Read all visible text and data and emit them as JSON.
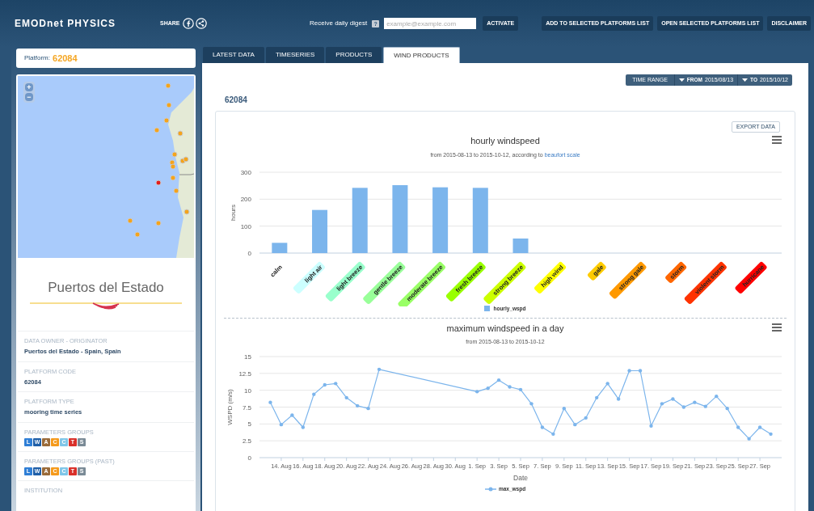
{
  "header": {
    "logo": "EMODnet PHYSICS",
    "share_label": "SHARE",
    "digest_label": "Receive daily digest",
    "help_badge": "?",
    "email_placeholder": "example@example.com",
    "buttons": [
      "ACTIVATE",
      "ADD TO SELECTED PLATFORMS LIST",
      "OPEN SELECTED PLATFORMS LIST",
      "DISCLAIMER"
    ]
  },
  "sidebar": {
    "platform_label": "Platform:",
    "platform_code": "62084",
    "map": {
      "zoom_in": "+",
      "zoom_out": "−"
    },
    "logo_text": "Puertos del Estado",
    "fields": [
      {
        "kind": "text",
        "label": "DATA OWNER - ORIGINATOR",
        "value": "Puertos del Estado - Spain, Spain"
      },
      {
        "kind": "text",
        "label": "PLATFORM CODE",
        "value": "62084"
      },
      {
        "kind": "text",
        "label": "PLATFORM TYPE",
        "value": "mooring time series"
      },
      {
        "kind": "badges",
        "label": "PARAMETERS GROUPS",
        "badges": [
          {
            "letter": "L",
            "color": "#2f7fd6"
          },
          {
            "letter": "W",
            "color": "#1f5fa8"
          },
          {
            "letter": "A",
            "color": "#9a6b3a"
          },
          {
            "letter": "C",
            "color": "#f59a1c"
          },
          {
            "letter": "C",
            "color": "#7fc6e8"
          },
          {
            "letter": "T",
            "color": "#d9302a"
          },
          {
            "letter": "S",
            "color": "#7a8a96"
          }
        ]
      },
      {
        "kind": "badges",
        "label": "PARAMETERS GROUPS (PAST)",
        "badges": [
          {
            "letter": "L",
            "color": "#2f7fd6"
          },
          {
            "letter": "W",
            "color": "#1f5fa8"
          },
          {
            "letter": "A",
            "color": "#9a6b3a"
          },
          {
            "letter": "C",
            "color": "#f59a1c"
          },
          {
            "letter": "C",
            "color": "#7fc6e8"
          },
          {
            "letter": "T",
            "color": "#d9302a"
          },
          {
            "letter": "S",
            "color": "#7a8a96"
          }
        ]
      },
      {
        "kind": "text",
        "label": "INSTITUTION"
      }
    ]
  },
  "tabs": [
    {
      "label": "LATEST DATA",
      "selected": false
    },
    {
      "label": "TIMESERIES",
      "selected": false
    },
    {
      "label": "PRODUCTS",
      "selected": false
    },
    {
      "label": "WIND PRODUCTS",
      "selected": true
    }
  ],
  "time_range": {
    "label": "TIME RANGE",
    "from_label": "FROM",
    "from": "2015/08/13",
    "to_label": "TO",
    "to": "2015/10/12"
  },
  "platform_heading": "62084",
  "export_button": "EXPORT DATA",
  "hourly_chart": {
    "title": "hourly windspeed",
    "subtitle": "from 2015-08-13 to 2015-10-12, according to",
    "subtitle_link": "beaufort scale",
    "category_tags": [
      {
        "kind": "plain"
      },
      {
        "kind": "tag",
        "color": "#ccffff"
      },
      {
        "kind": "tag",
        "color": "#99ffcc"
      },
      {
        "kind": "tag",
        "color": "#99ff99"
      },
      {
        "kind": "tag",
        "color": "#99ff66"
      },
      {
        "kind": "tag",
        "color": "#99ff00"
      },
      {
        "kind": "tag",
        "color": "#ccff00"
      },
      {
        "kind": "tag",
        "color": "#ffff00"
      },
      {
        "kind": "tag",
        "color": "#ffcc00"
      },
      {
        "kind": "tag",
        "color": "#ff9900"
      },
      {
        "kind": "tag",
        "color": "#ff6600"
      },
      {
        "kind": "tag",
        "color": "#ff3300"
      },
      {
        "kind": "tag",
        "color": "#ff0000"
      }
    ],
    "chart_data": {
      "type": "bar",
      "ylabel": "hours",
      "categories": [
        "calm",
        "light air",
        "light breeze",
        "gentle breeze",
        "moderate breeze",
        "fresh breeze",
        "strong breeze",
        "high wind",
        "gale",
        "strong gale",
        "storm",
        "violent storm",
        "hurricane"
      ],
      "series": [
        {
          "name": "hourly_wspd",
          "color": "#7cb5ec",
          "values": [
            38,
            160,
            242,
            252,
            244,
            242,
            54,
            0,
            0,
            0,
            0,
            0,
            0
          ]
        }
      ],
      "ylim": [
        0,
        300
      ],
      "yticks": [
        0,
        100,
        200,
        300
      ]
    }
  },
  "daily_chart": {
    "title": "maximum windspeed in a day",
    "subtitle": "from 2015-08-13 to 2015-10-12",
    "chart_data": {
      "type": "line",
      "xlabel": "Date",
      "ylabel": "WSPD (m/s)",
      "x": [
        "2015-08-13",
        "2015-08-14",
        "2015-08-15",
        "2015-08-16",
        "2015-08-17",
        "2015-08-18",
        "2015-08-19",
        "2015-08-20",
        "2015-08-21",
        "2015-08-22",
        "2015-08-23",
        "2015-09-01",
        "2015-09-02",
        "2015-09-03",
        "2015-09-04",
        "2015-09-05",
        "2015-09-06",
        "2015-09-07",
        "2015-09-08",
        "2015-09-09",
        "2015-09-10",
        "2015-09-11",
        "2015-09-12",
        "2015-09-13",
        "2015-09-14",
        "2015-09-15",
        "2015-09-16",
        "2015-09-17",
        "2015-09-18",
        "2015-09-19",
        "2015-09-20",
        "2015-09-21",
        "2015-09-22",
        "2015-09-23",
        "2015-09-24",
        "2015-09-25",
        "2015-09-26",
        "2015-09-27",
        "2015-09-28"
      ],
      "series": [
        {
          "name": "max_wspd",
          "color": "#7cb5ec",
          "values": [
            8.2,
            4.9,
            6.3,
            4.5,
            9.4,
            10.8,
            11.0,
            8.9,
            7.7,
            7.3,
            13.1,
            9.8,
            10.3,
            11.5,
            10.5,
            10.1,
            8.0,
            4.5,
            3.5,
            7.3,
            4.9,
            5.9,
            8.9,
            11.0,
            8.7,
            12.9,
            12.9,
            4.7,
            8.0,
            8.7,
            7.5,
            8.2,
            7.6,
            9.1,
            7.3,
            4.5,
            2.8,
            4.5,
            3.5
          ]
        }
      ],
      "ylim": [
        0,
        15
      ],
      "yticks": [
        0,
        2.5,
        5,
        7.5,
        10,
        12.5,
        15
      ],
      "grid": true,
      "xlim": [
        "2015-08-12",
        "2015-09-29"
      ],
      "xticks": [
        {
          "value": "2015-08-14",
          "label": "14. Aug"
        },
        {
          "value": "2015-08-16",
          "label": "16. Aug"
        },
        {
          "value": "2015-08-18",
          "label": "18. Aug"
        },
        {
          "value": "2015-08-20",
          "label": "20. Aug"
        },
        {
          "value": "2015-08-22",
          "label": "22. Aug"
        },
        {
          "value": "2015-08-24",
          "label": "24. Aug"
        },
        {
          "value": "2015-08-26",
          "label": "26. Aug"
        },
        {
          "value": "2015-08-28",
          "label": "28. Aug"
        },
        {
          "value": "2015-08-30",
          "label": "30. Aug"
        },
        {
          "value": "2015-09-01",
          "label": "1. Sep"
        },
        {
          "value": "2015-09-03",
          "label": "3. Sep"
        },
        {
          "value": "2015-09-05",
          "label": "5. Sep"
        },
        {
          "value": "2015-09-07",
          "label": "7. Sep"
        },
        {
          "value": "2015-09-09",
          "label": "9. Sep"
        },
        {
          "value": "2015-09-11",
          "label": "11. Sep"
        },
        {
          "value": "2015-09-13",
          "label": "13. Sep"
        },
        {
          "value": "2015-09-15",
          "label": "15. Sep"
        },
        {
          "value": "2015-09-17",
          "label": "17. Sep"
        },
        {
          "value": "2015-09-19",
          "label": "19. Sep"
        },
        {
          "value": "2015-09-21",
          "label": "21. Sep"
        },
        {
          "value": "2015-09-23",
          "label": "23. Sep"
        },
        {
          "value": "2015-09-25",
          "label": "25. Sep"
        },
        {
          "value": "2015-09-27",
          "label": "27. Sep"
        }
      ]
    }
  }
}
